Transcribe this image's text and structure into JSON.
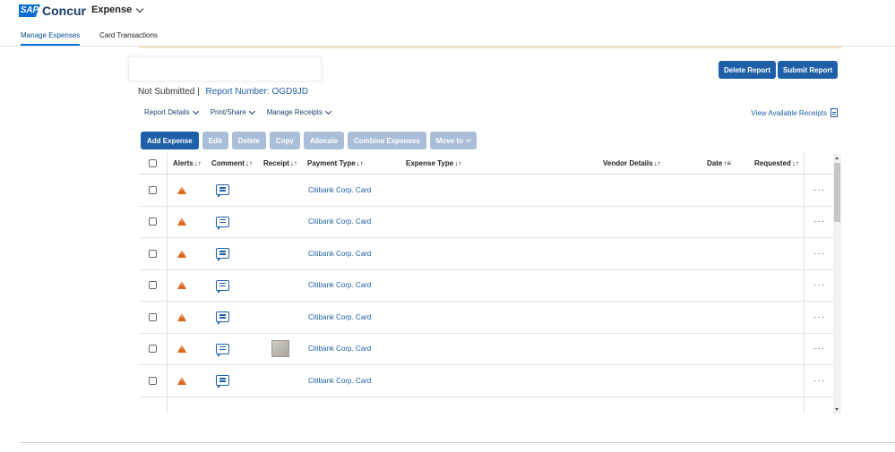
{
  "brand": {
    "sap": "SAP",
    "concur": "Concur"
  },
  "app_menu": {
    "label": "Expense"
  },
  "nav_tabs": [
    {
      "label": "Manage Expenses",
      "active": true
    },
    {
      "label": "Card Transactions",
      "active": false
    }
  ],
  "report": {
    "status": "Not Submitted |",
    "number_label": "Report Number: OGD9JD",
    "delete_label": "Delete Report",
    "submit_label": "Submit Report"
  },
  "report_menus": [
    {
      "label": "Report Details"
    },
    {
      "label": "Print/Share"
    },
    {
      "label": "Manage Receipts"
    }
  ],
  "view_receipts_label": "View Available Receipts",
  "toolbar": {
    "add_expense": "Add Expense",
    "edit": "Edit",
    "delete": "Delete",
    "copy": "Copy",
    "allocate": "Allocate",
    "combine": "Combine Expenses",
    "move_to": "Move to"
  },
  "columns": {
    "alerts": "Alerts",
    "comment": "Comment",
    "receipt": "Receipt",
    "payment_type": "Payment Type",
    "expense_type": "Expense Type",
    "vendor": "Vendor Details",
    "date": "Date",
    "requested": "Requested",
    "sort_both": "↓↑",
    "sort_date": "↑≡"
  },
  "rows": [
    {
      "payment_type": "Citibank Corp. Card",
      "has_receipt": false
    },
    {
      "payment_type": "Citibank Corp. Card",
      "has_receipt": false
    },
    {
      "payment_type": "Citibank Corp. Card",
      "has_receipt": false
    },
    {
      "payment_type": "Citibank Corp. Card",
      "has_receipt": false
    },
    {
      "payment_type": "Citibank Corp. Card",
      "has_receipt": false
    },
    {
      "payment_type": "Citibank Corp. Card",
      "has_receipt": true
    },
    {
      "payment_type": "Citibank Corp. Card",
      "has_receipt": false
    }
  ],
  "row_more": "···",
  "colors": {
    "primary": "#1f5fa8",
    "disabled": "#a9bed8",
    "warning": "#e0661b"
  }
}
